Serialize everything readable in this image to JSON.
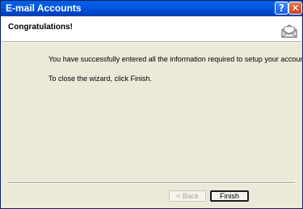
{
  "window": {
    "title": "E-mail Accounts",
    "help_glyph": "?",
    "close_glyph": "✕"
  },
  "header": {
    "title": "Congratulations!",
    "icon": "envelope-icon"
  },
  "body": {
    "line1": "You have successfully entered all the information required to setup your account.",
    "line2": "To close the wizard, click Finish."
  },
  "buttons": {
    "back_label": "< Back",
    "back_enabled": false,
    "finish_label": "Finish"
  },
  "colors": {
    "titlebar": "#0058e6",
    "dialog_bg": "#ece9d8",
    "header_bg": "#ffffff"
  }
}
